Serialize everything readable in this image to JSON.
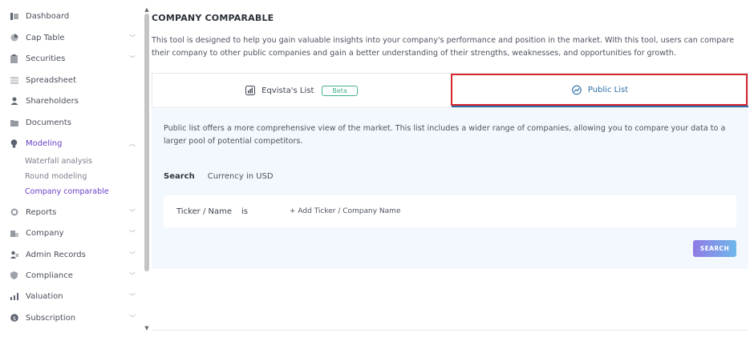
{
  "sidebar": {
    "items": [
      {
        "label": "Dashboard",
        "icon": "dashboard-icon",
        "has_chevron": false
      },
      {
        "label": "Cap Table",
        "icon": "pie-chart-icon",
        "has_chevron": true
      },
      {
        "label": "Securities",
        "icon": "clipboard-icon",
        "has_chevron": true
      },
      {
        "label": "Spreadsheet",
        "icon": "spreadsheet-icon",
        "has_chevron": false
      },
      {
        "label": "Shareholders",
        "icon": "person-icon",
        "has_chevron": false
      },
      {
        "label": "Documents",
        "icon": "folder-icon",
        "has_chevron": false
      },
      {
        "label": "Modeling",
        "icon": "lightbulb-icon",
        "has_chevron": true,
        "expanded": true
      },
      {
        "label": "Reports",
        "icon": "reports-icon",
        "has_chevron": true
      },
      {
        "label": "Company",
        "icon": "building-icon",
        "has_chevron": true
      },
      {
        "label": "Admin Records",
        "icon": "admin-records-icon",
        "has_chevron": true
      },
      {
        "label": "Compliance",
        "icon": "shield-icon",
        "has_chevron": true
      },
      {
        "label": "Valuation",
        "icon": "valuation-icon",
        "has_chevron": true
      },
      {
        "label": "Subscription",
        "icon": "dollar-icon",
        "has_chevron": true
      }
    ],
    "modeling_sub": [
      {
        "label": "Waterfall analysis"
      },
      {
        "label": "Round modeling"
      },
      {
        "label": "Company comparable",
        "active": true
      }
    ]
  },
  "main": {
    "title": "COMPANY COMPARABLE",
    "intro": "This tool is designed to help you gain valuable insights into your company's performance and position in the market. With this tool, users can compare their company to other public companies and gain a better understanding of their strengths, weaknesses, and opportunities for growth.",
    "tabs": [
      {
        "label": "Eqvista's List",
        "badge": "Beta",
        "icon": "bar-chart-icon"
      },
      {
        "label": "Public List",
        "icon": "globe-chart-icon",
        "active": true
      }
    ],
    "panel": {
      "description": "Public list offers a more comprehensive view of the market. This list includes a wider range of companies, allowing you to compare your data to a larger pool of potential competitors.",
      "search_label": "Search",
      "currency": "Currency in USD",
      "filter": {
        "field": "Ticker / Name",
        "operator": "is",
        "add_label": "+ Add Ticker / Company Name"
      },
      "search_button": "SEARCH"
    }
  },
  "colors": {
    "accent_purple": "#6b3fc7",
    "tab_active_blue": "#2b6fa8",
    "highlight_red": "#d8262f",
    "beta_green": "#45b08a",
    "panel_bg": "#f2f8fd"
  }
}
